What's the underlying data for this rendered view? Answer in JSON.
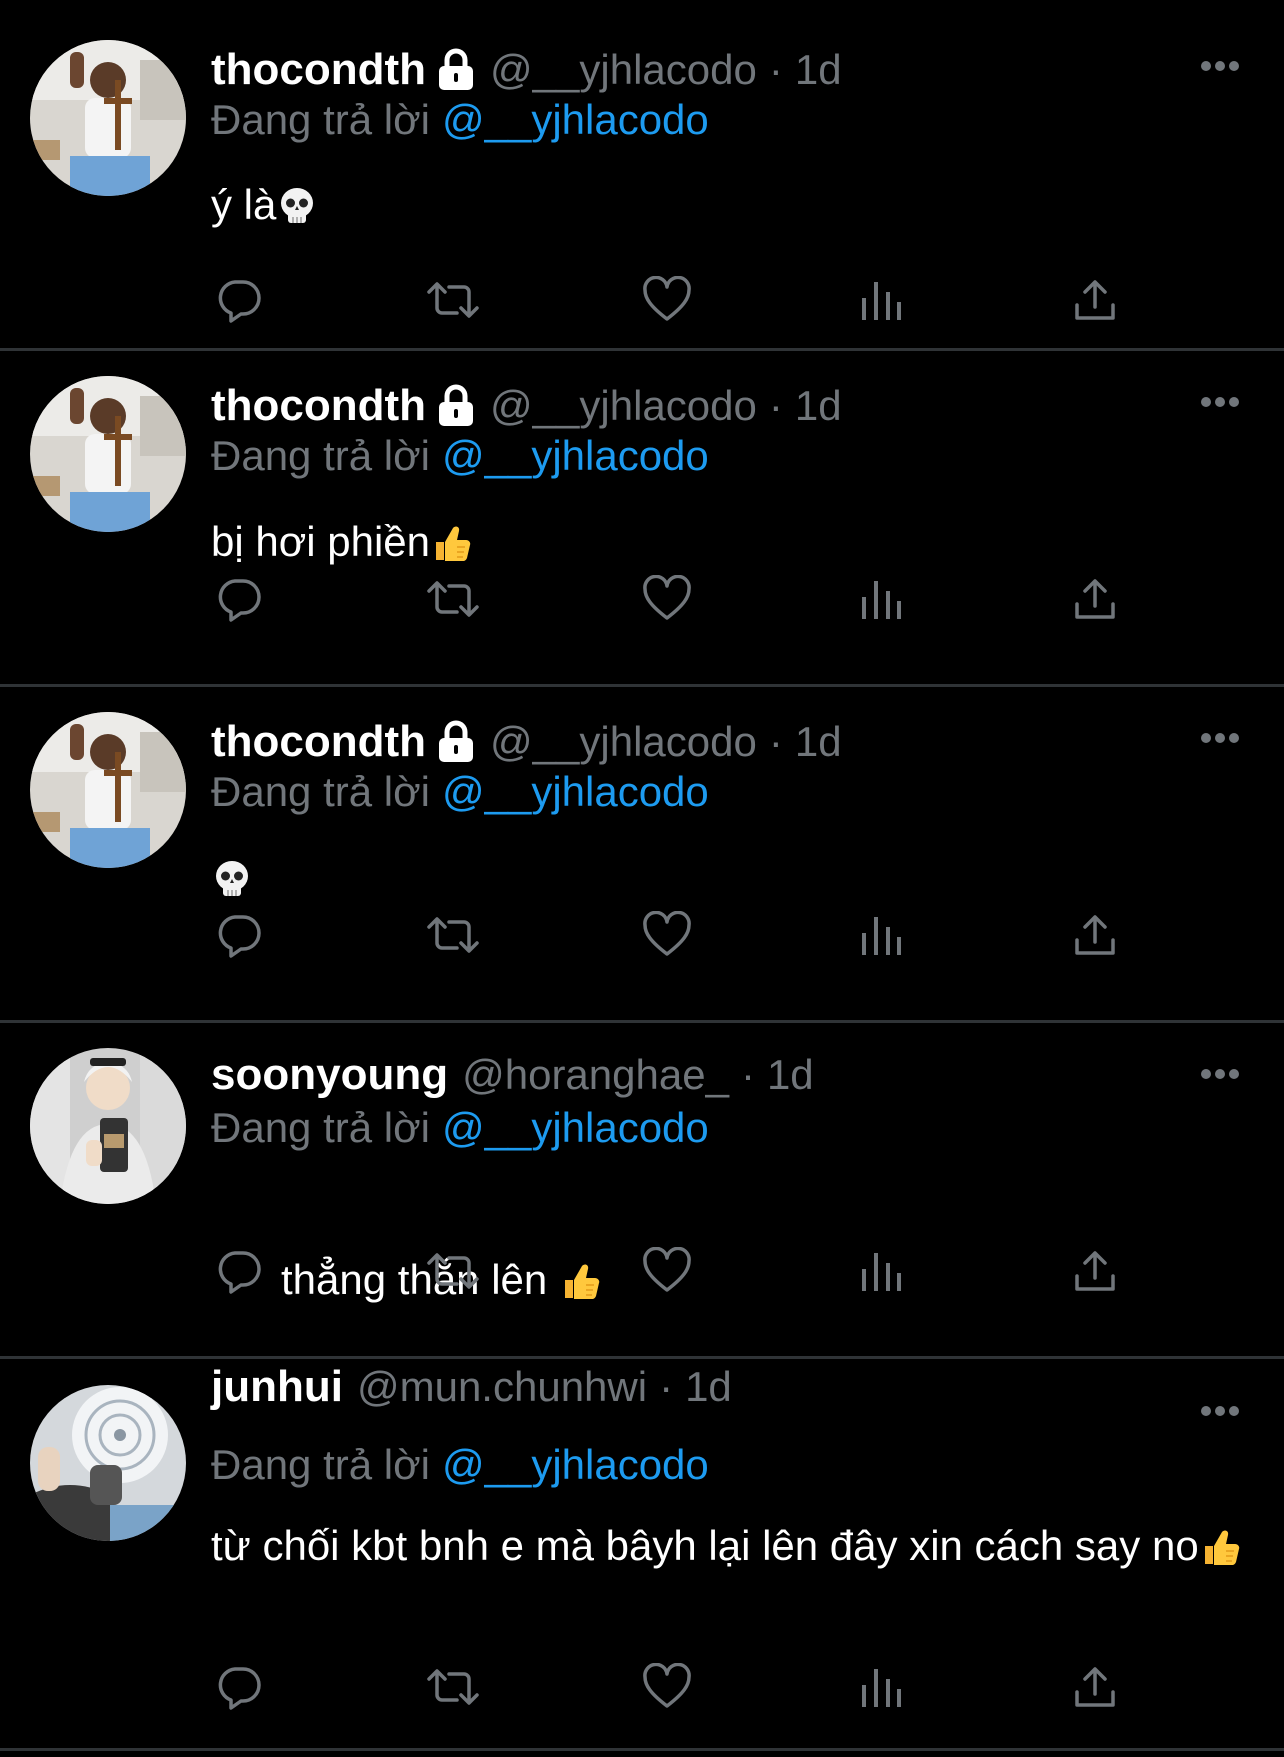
{
  "reply_prefix": "Đang trả lời",
  "colors": {
    "background": "#000000",
    "text": "#ffffff",
    "secondary": "#71767b",
    "accent": "#1d9bf0",
    "divider": "#2f3336"
  },
  "tweets": [
    {
      "display_name": "thocondth",
      "protected": true,
      "handle": "@__yjhlacodo",
      "separator": "·",
      "time": "1d",
      "replying_to": "@__yjhlacodo",
      "text": "ý là",
      "emoji": "skull"
    },
    {
      "display_name": "thocondth",
      "protected": true,
      "handle": "@__yjhlacodo",
      "separator": "·",
      "time": "1d",
      "replying_to": "@__yjhlacodo",
      "text": "bị hơi phiền",
      "emoji": "thumbs-up"
    },
    {
      "display_name": "thocondth",
      "protected": true,
      "handle": "@__yjhlacodo",
      "separator": "·",
      "time": "1d",
      "replying_to": "@__yjhlacodo",
      "text": "",
      "emoji": "skull"
    },
    {
      "display_name": "soonyoung",
      "protected": false,
      "handle": "@horanghae_",
      "separator": "·",
      "time": "1d",
      "replying_to": "@__yjhlacodo",
      "text": "thẳng thắn lên ",
      "emoji": "thumbs-up"
    },
    {
      "display_name": "junhui",
      "protected": false,
      "handle": "@mun.chunhwi",
      "separator": "·",
      "time": "1d",
      "replying_to": "@__yjhlacodo",
      "text": "từ chối kbt bnh e mà bâyh lại lên đây xin cách say no",
      "emoji": "thumbs-up"
    }
  ],
  "actions": [
    "reply-icon",
    "retweet-icon",
    "like-icon",
    "views-icon",
    "share-icon"
  ]
}
